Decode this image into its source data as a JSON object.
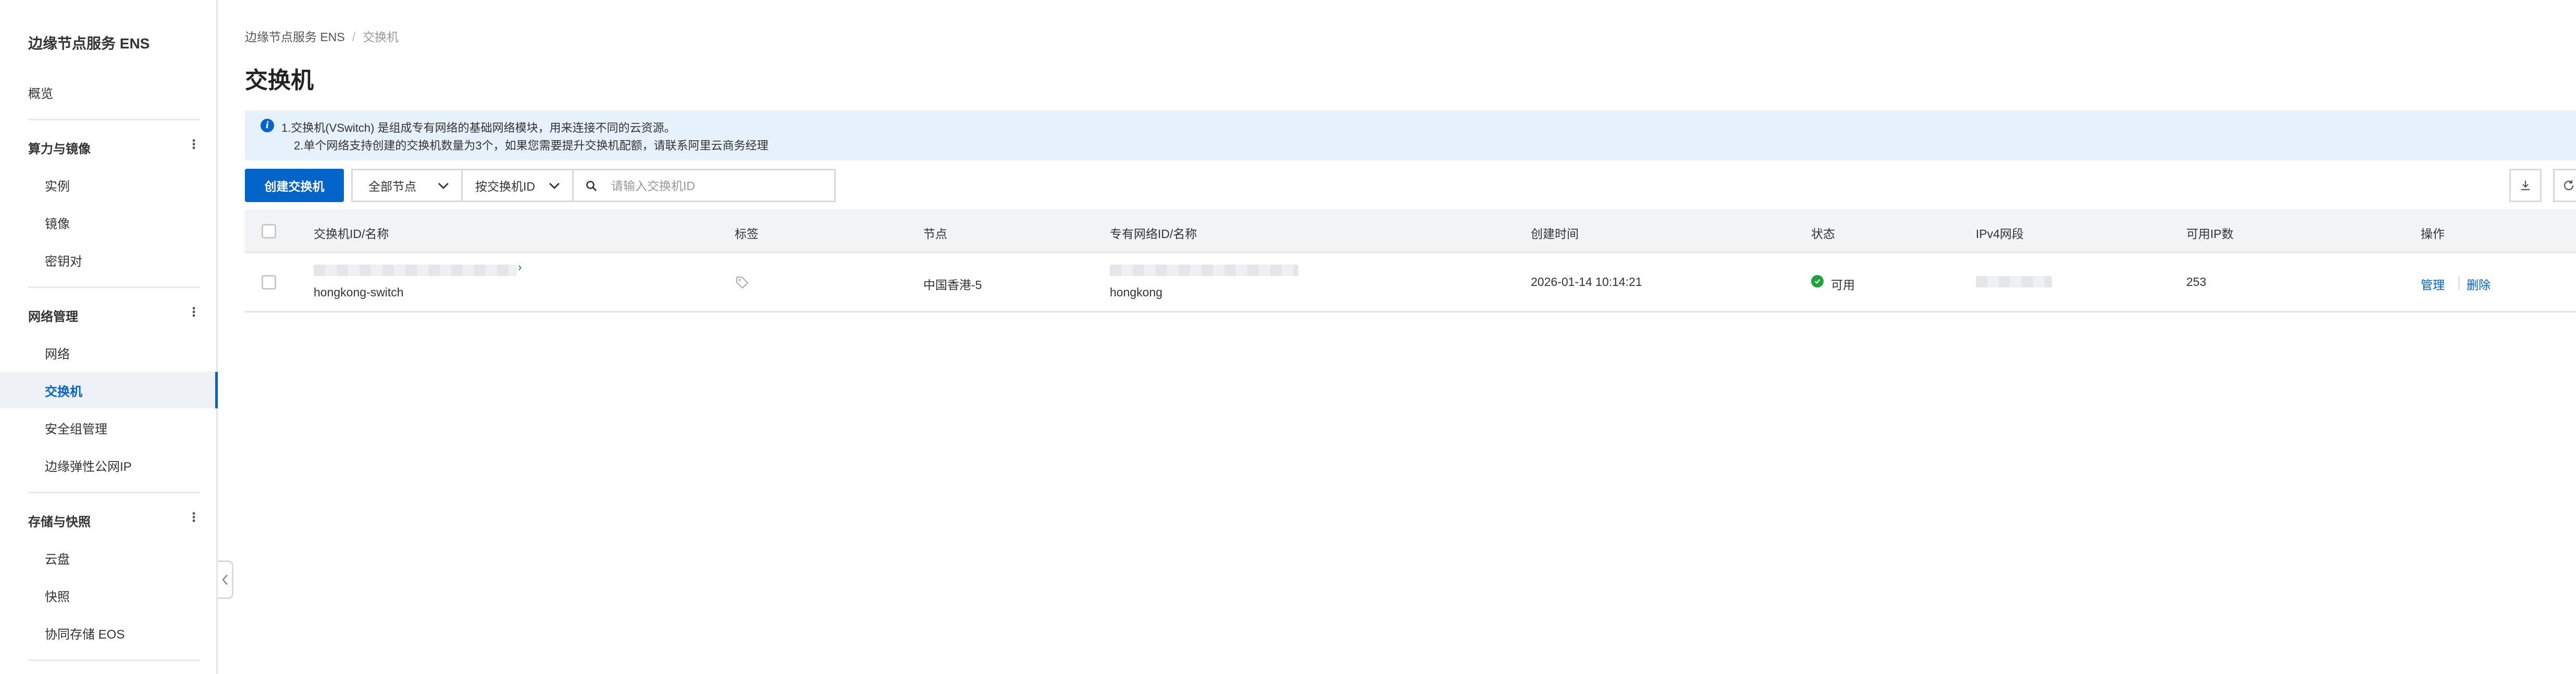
{
  "sidebar": {
    "title": "边缘节点服务 ENS",
    "overview": "概览",
    "groups": [
      {
        "label": "算力与镜像",
        "more_icon": "more-vertical-icon",
        "items": [
          "实例",
          "镜像",
          "密钥对"
        ]
      },
      {
        "label": "网络管理",
        "more_icon": "more-vertical-icon",
        "items": [
          "网络",
          "交换机",
          "安全组管理",
          "边缘弹性公网IP"
        ]
      },
      {
        "label": "存储与快照",
        "more_icon": "more-vertical-icon",
        "items": [
          "云盘",
          "快照",
          "协同存储 EOS"
        ]
      }
    ],
    "active_item": "交换机"
  },
  "breadcrumb": {
    "root": "边缘节点服务 ENS",
    "current": "交换机"
  },
  "page": {
    "title": "交换机"
  },
  "notice": {
    "icon": "info-icon",
    "line1": "1.交换机(VSwitch) 是组成专有网络的基础网络模块，用来连接不同的云资源。",
    "line2": "2.单个网络支持创建的交换机数量为3个，如果您需要提升交换机配额，请联系阿里云商务经理"
  },
  "toolbar": {
    "create_label": "创建交换机",
    "node_filter": "全部节点",
    "search_type": "按交换机ID",
    "search_placeholder": "请输入交换机ID"
  },
  "table": {
    "headers": [
      "交换机ID/名称",
      "标签",
      "节点",
      "专有网络ID/名称",
      "创建时间",
      "状态",
      "IPv4网段",
      "可用IP数",
      "操作"
    ],
    "rows": [
      {
        "switch_name": "hongkong-switch",
        "node": "中国香港-5",
        "vpc_name": "hongkong",
        "created": "2026-01-14 10:14:21",
        "status": "可用",
        "available_ips": "253",
        "actions": [
          "管理",
          "删除"
        ]
      }
    ]
  },
  "colors": {
    "primary": "#0064c8",
    "notice_bg": "#e6f1fb",
    "status_ok": "#1fa33a",
    "header_bg": "#f2f3f5"
  }
}
